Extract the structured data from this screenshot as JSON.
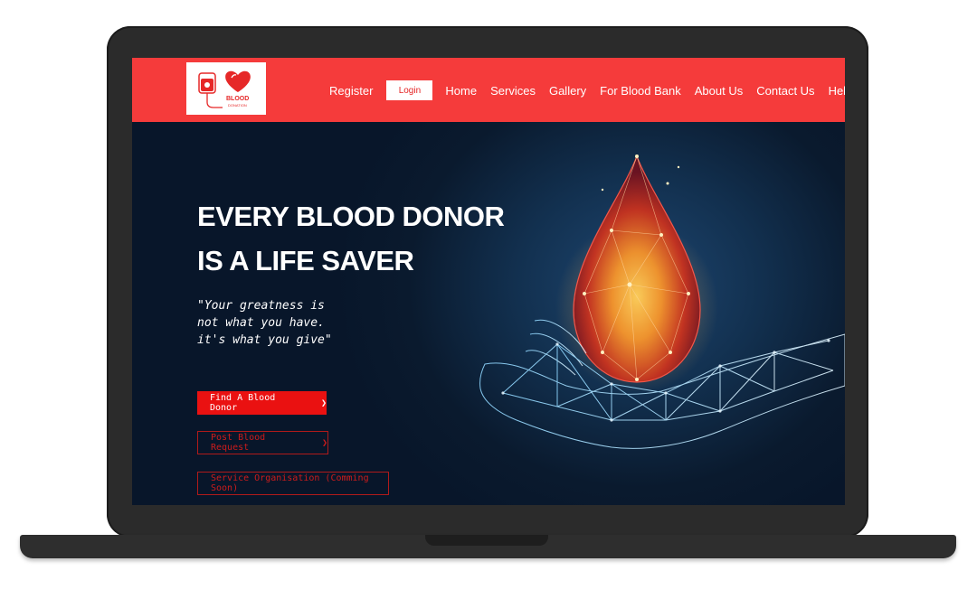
{
  "logo": {
    "title": "BLOOD",
    "subtitle": "DONATION"
  },
  "nav": {
    "register": "Register",
    "login": "Login",
    "home": "Home",
    "services": "Services",
    "gallery": "Gallery",
    "blood_bank": "For Blood Bank",
    "about": "About Us",
    "contact": "Contact Us",
    "help": "Help"
  },
  "hero": {
    "headline_line1": "EVERY BLOOD DONOR",
    "headline_line2": "IS A LIFE SAVER",
    "quote": "\"Your greatness is\nnot what you have.\nit's what you give\"",
    "buttons": {
      "find_donor": "Find A Blood Donor",
      "post_request": "Post Blood Request",
      "service_org": "Service Organisation (Comming Soon)",
      "chevron": "❯"
    }
  },
  "colors": {
    "header": "#f53b3b",
    "accent": "#ea1111",
    "hero_bg": "#0b1b30"
  },
  "icons": [
    "blood-bag-icon",
    "heart-icon",
    "blood-drop-icon",
    "hand-icon",
    "chevron-right-icon"
  ]
}
